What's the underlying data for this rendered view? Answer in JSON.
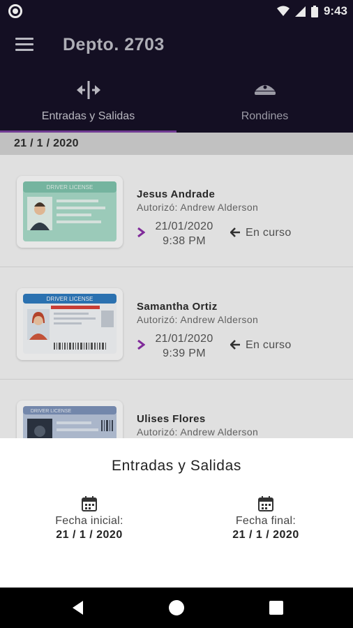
{
  "status_bar": {
    "time": "9:43"
  },
  "header": {
    "title": "Depto. 2703"
  },
  "tabs": [
    {
      "label": "Entradas y Salidas",
      "icon": "expand-horizontal-icon",
      "active": true
    },
    {
      "label": "Rondines",
      "icon": "guard-cap-icon",
      "active": false
    }
  ],
  "date_header": "21 / 1 / 2020",
  "entries": [
    {
      "name": "Jesus Andrade",
      "authorized": "Autorizó: Andrew Alderson",
      "entry_date": "21/01/2020",
      "entry_time": "9:38 PM",
      "status": "En curso",
      "card_style": "green"
    },
    {
      "name": "Samantha Ortiz",
      "authorized": "Autorizó: Andrew Alderson",
      "entry_date": "21/01/2020",
      "entry_time": "9:39 PM",
      "status": "En curso",
      "card_style": "blue-red"
    },
    {
      "name": "Ulises Flores",
      "authorized": "Autorizó: Andrew Alderson",
      "entry_date": "",
      "entry_time": "",
      "status": "",
      "card_style": "blue"
    }
  ],
  "card_text": "DRIVER LICENSE",
  "sheet": {
    "title": "Entradas y Salidas",
    "start": {
      "label": "Fecha inicial:",
      "value": "21 / 1 / 2020"
    },
    "end": {
      "label": "Fecha final:",
      "value": "21 / 1 / 2020"
    }
  },
  "colors": {
    "header_bg": "#161127",
    "accent": "#7a3fa0"
  }
}
